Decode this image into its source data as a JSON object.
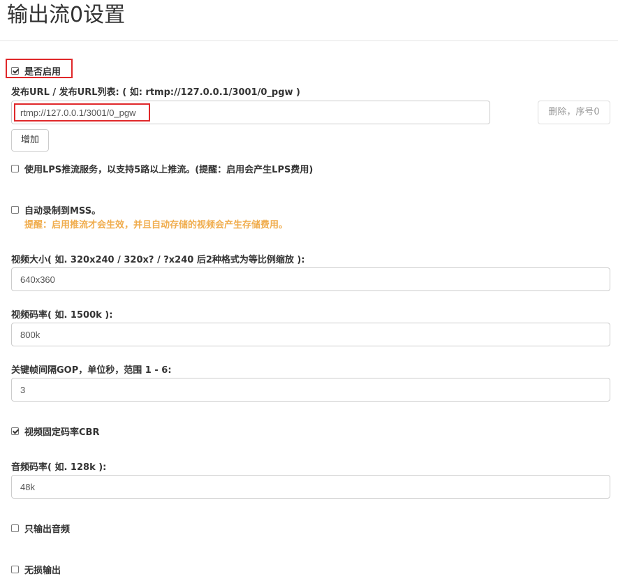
{
  "page": {
    "title": "输出流0设置"
  },
  "enable": {
    "label": "是否启用",
    "checked": true
  },
  "publish": {
    "label": "发布URL / 发布URL列表: ( 如: rtmp://127.0.0.1/3001/0_pgw )",
    "url_value": "rtmp://127.0.0.1/3001/0_pgw",
    "delete_label": "删除，序号0",
    "add_label": "增加"
  },
  "lps": {
    "label": "使用LPS推流服务，以支持5路以上推流。(提醒：启用会产生LPS费用)",
    "checked": false
  },
  "mss": {
    "label": "自动录制到MSS。",
    "warning": "提醒：启用推流才会生效，并且自动存储的视频会产生存储费用。",
    "checked": false
  },
  "video_size": {
    "label": "视频大小( 如. 320x240 / 320x? / ?x240 后2种格式为等比例缩放 ):",
    "value": "640x360"
  },
  "video_bitrate": {
    "label": "视频码率( 如. 1500k ):",
    "value": "800k"
  },
  "gop": {
    "label": "关键帧间隔GOP，单位秒，范围 1 - 6:",
    "value": "3"
  },
  "cbr": {
    "label": "视频固定码率CBR",
    "checked": true
  },
  "audio_bitrate": {
    "label": "音频码率( 如. 128k ):",
    "value": "48k"
  },
  "audio_only": {
    "label": "只输出音频",
    "checked": false
  },
  "lossless": {
    "label": "无损输出",
    "checked": false
  },
  "colors": {
    "highlight": "#e0282a",
    "warning": "#f0ad4e"
  }
}
